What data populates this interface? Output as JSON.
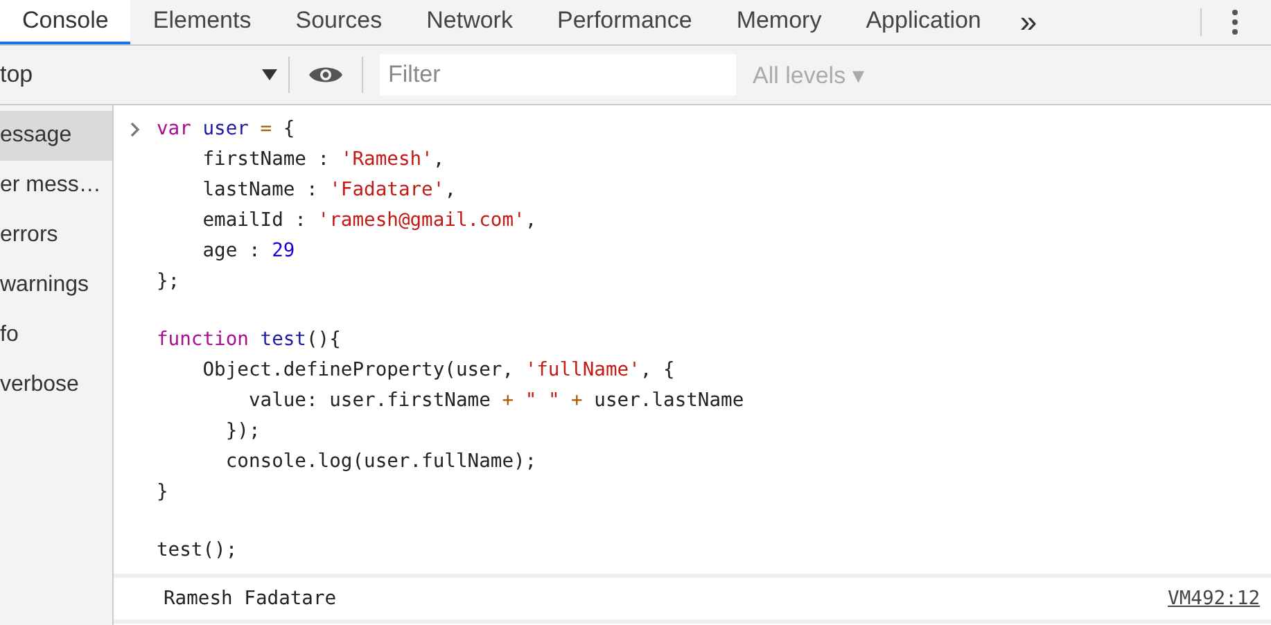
{
  "tabs": [
    {
      "label": "Console",
      "selected": true
    },
    {
      "label": "Elements",
      "selected": false
    },
    {
      "label": "Sources",
      "selected": false
    },
    {
      "label": "Network",
      "selected": false
    },
    {
      "label": "Performance",
      "selected": false
    },
    {
      "label": "Memory",
      "selected": false
    },
    {
      "label": "Application",
      "selected": false
    }
  ],
  "more_tabs": "»",
  "toolbar": {
    "context": "top",
    "filter": {
      "placeholder": "Filter"
    },
    "levels": "All levels ▾"
  },
  "sidebar": {
    "items": [
      {
        "label": "essage",
        "selected": true
      },
      {
        "label": "er mess…",
        "selected": false
      },
      {
        "label": "errors",
        "selected": false
      },
      {
        "label": "warnings",
        "selected": false
      },
      {
        "label": "fo",
        "selected": false
      },
      {
        "label": "verbose",
        "selected": false
      }
    ]
  },
  "input": {
    "blocks": [
      [
        [
          {
            "kind": "keyword",
            "text": "var "
          },
          {
            "kind": "name",
            "text": "user"
          },
          {
            "kind": "operator",
            "text": " = "
          },
          {
            "kind": "plain",
            "text": "{"
          }
        ],
        [
          {
            "kind": "plain",
            "text": "    firstName : "
          },
          {
            "kind": "string",
            "text": "'Ramesh'"
          },
          {
            "kind": "plain",
            "text": ","
          }
        ],
        [
          {
            "kind": "plain",
            "text": "    lastName : "
          },
          {
            "kind": "string",
            "text": "'Fadatare'"
          },
          {
            "kind": "plain",
            "text": ","
          }
        ],
        [
          {
            "kind": "plain",
            "text": "    emailId : "
          },
          {
            "kind": "string",
            "text": "'ramesh@gmail.com'"
          },
          {
            "kind": "plain",
            "text": ","
          }
        ],
        [
          {
            "kind": "plain",
            "text": "    age : "
          },
          {
            "kind": "number",
            "text": "29"
          }
        ],
        [
          {
            "kind": "plain",
            "text": "};"
          }
        ]
      ],
      [
        [
          {
            "kind": "keyword",
            "text": "function "
          },
          {
            "kind": "name",
            "text": "test"
          },
          {
            "kind": "plain",
            "text": "(){"
          }
        ],
        [
          {
            "kind": "plain",
            "text": "    Object.defineProperty(user, "
          },
          {
            "kind": "string",
            "text": "'fullName'"
          },
          {
            "kind": "plain",
            "text": ", {"
          }
        ],
        [
          {
            "kind": "plain",
            "text": "        value: user.firstName "
          },
          {
            "kind": "operator",
            "text": "+ "
          },
          {
            "kind": "string",
            "text": "\" \""
          },
          {
            "kind": "operator",
            "text": " + "
          },
          {
            "kind": "plain",
            "text": "user.lastName"
          }
        ],
        [
          {
            "kind": "plain",
            "text": "      });"
          }
        ],
        [
          {
            "kind": "plain",
            "text": "      console.log(user.fullName);"
          }
        ],
        [
          {
            "kind": "plain",
            "text": "}"
          }
        ]
      ],
      [
        [
          {
            "kind": "plain",
            "text": "test();"
          }
        ]
      ]
    ]
  },
  "output": {
    "text": "Ramesh Fadatare",
    "source": "VM492:12"
  }
}
